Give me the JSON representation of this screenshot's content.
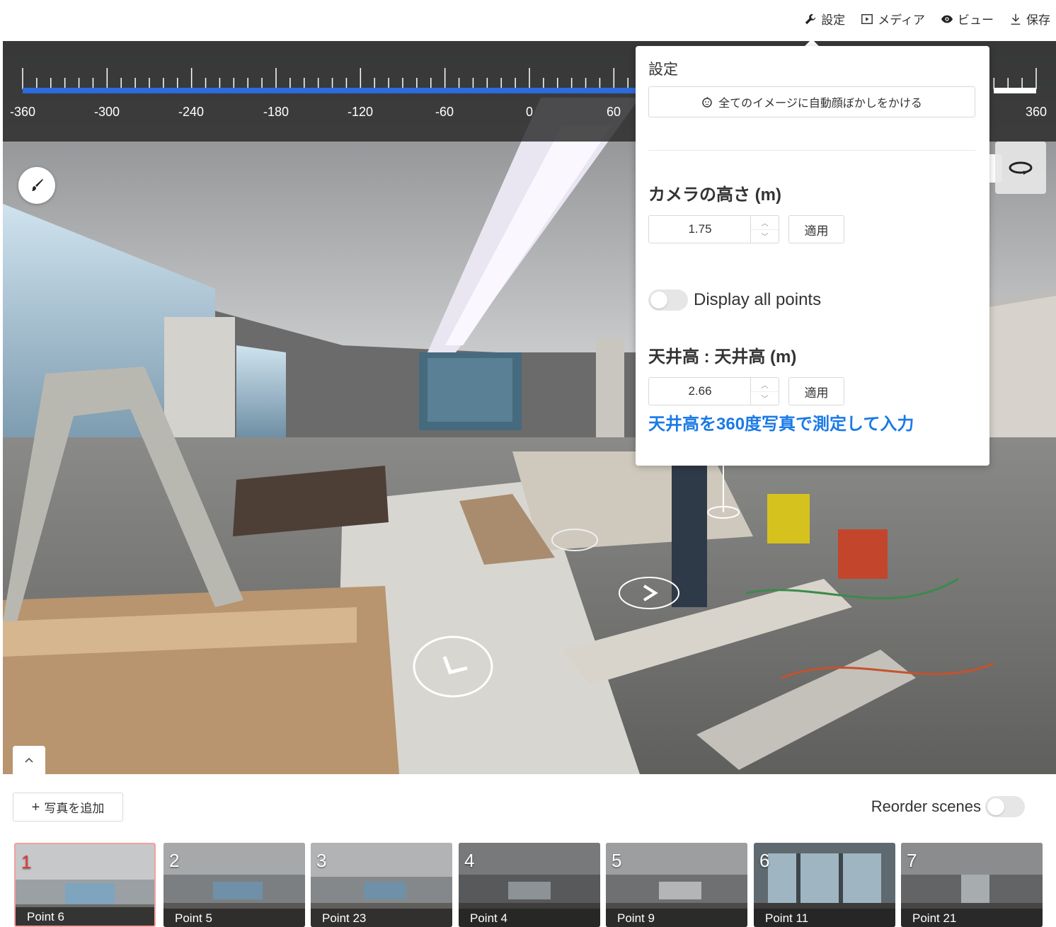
{
  "toolbar": {
    "settings_label": "設定",
    "media_label": "メディア",
    "view_label": "ビュー",
    "save_label": "保存"
  },
  "ruler": {
    "labels": [
      "-360",
      "-300",
      "-240",
      "-180",
      "-120",
      "-60",
      "0",
      "60",
      "360"
    ]
  },
  "settings_panel": {
    "title": "設定",
    "auto_blur_label": "全てのイメージに自動顔ぼかしをかける",
    "camera_height_label": "カメラの高さ (m)",
    "camera_height_value": "1.75",
    "apply_label": "適用",
    "display_points_label": "Display all points",
    "ceiling_height_label": "天井高 : 天井高 (m)",
    "ceiling_height_value": "2.66",
    "measure_link": "天井高を360度写真で測定して入力"
  },
  "bottom": {
    "add_photo_label": "写真を追加",
    "reorder_label": "Reorder scenes"
  },
  "scenes": [
    {
      "num": "1",
      "name": "Point 6"
    },
    {
      "num": "2",
      "name": "Point 5"
    },
    {
      "num": "3",
      "name": "Point 23"
    },
    {
      "num": "4",
      "name": "Point 4"
    },
    {
      "num": "5",
      "name": "Point 9"
    },
    {
      "num": "6",
      "name": "Point 11"
    },
    {
      "num": "7",
      "name": "Point 21"
    }
  ],
  "colors": {
    "accent": "#1a7ae6",
    "ruler_bar": "#2e6bdc",
    "active_scene": "#e43a3a"
  }
}
